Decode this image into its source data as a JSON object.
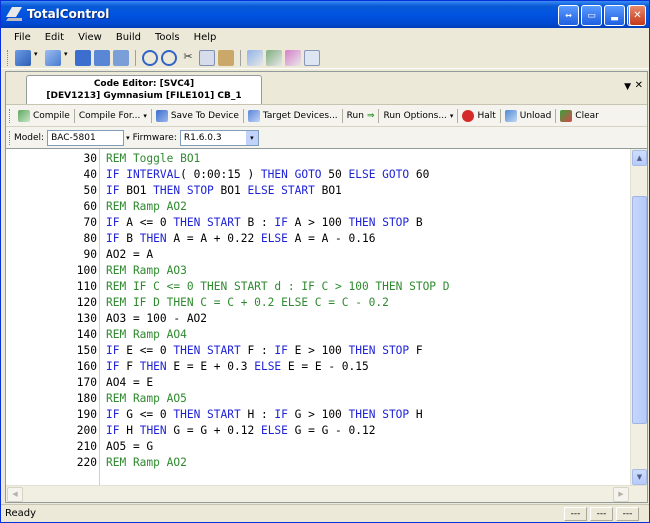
{
  "window": {
    "title": "TotalControl"
  },
  "menu": [
    "File",
    "Edit",
    "View",
    "Build",
    "Tools",
    "Help"
  ],
  "document_tab": {
    "line1": "Code Editor: [SVC4]",
    "line2": "[DEV1213] Gymnasium [FILE101] CB_1"
  },
  "commands": {
    "compile": "Compile",
    "compile_for": "Compile For...",
    "save_to_device": "Save To Device",
    "target_devices": "Target Devices...",
    "run": "Run",
    "run_options": "Run Options...",
    "halt": "Halt",
    "unload": "Unload",
    "clear": "Clear"
  },
  "model": {
    "label": "Model:",
    "value": "BAC-5801"
  },
  "firmware": {
    "label": "Firmware:",
    "value": "R1.6.0.3"
  },
  "code_lines": [
    {
      "num": "30",
      "tokens": [
        {
          "t": "REM Toggle BO1",
          "c": "cm"
        }
      ]
    },
    {
      "num": "40",
      "tokens": [
        {
          "t": "IF INTERVAL",
          "c": "kw"
        },
        {
          "t": "( 0:00:15 ) ",
          "c": ""
        },
        {
          "t": "THEN GOTO",
          "c": "kw"
        },
        {
          "t": " 50 ",
          "c": ""
        },
        {
          "t": "ELSE GOTO",
          "c": "kw"
        },
        {
          "t": " 60",
          "c": ""
        }
      ]
    },
    {
      "num": "50",
      "tokens": [
        {
          "t": "IF",
          "c": "kw"
        },
        {
          "t": " BO1 ",
          "c": ""
        },
        {
          "t": "THEN STOP",
          "c": "kw"
        },
        {
          "t": " BO1 ",
          "c": ""
        },
        {
          "t": "ELSE START",
          "c": "kw"
        },
        {
          "t": " BO1",
          "c": ""
        }
      ]
    },
    {
      "num": "60",
      "tokens": [
        {
          "t": "REM Ramp AO2",
          "c": "cm"
        }
      ]
    },
    {
      "num": "70",
      "tokens": [
        {
          "t": "IF",
          "c": "kw"
        },
        {
          "t": " A <= 0 ",
          "c": ""
        },
        {
          "t": "THEN START",
          "c": "kw"
        },
        {
          "t": " B : ",
          "c": ""
        },
        {
          "t": "IF",
          "c": "kw"
        },
        {
          "t": " A > 100 ",
          "c": ""
        },
        {
          "t": "THEN STOP",
          "c": "kw"
        },
        {
          "t": " B",
          "c": ""
        }
      ]
    },
    {
      "num": "80",
      "tokens": [
        {
          "t": "IF",
          "c": "kw"
        },
        {
          "t": " B ",
          "c": ""
        },
        {
          "t": "THEN",
          "c": "kw"
        },
        {
          "t": " A = A + 0.22 ",
          "c": ""
        },
        {
          "t": "ELSE",
          "c": "kw"
        },
        {
          "t": " A = A - 0.16",
          "c": ""
        }
      ]
    },
    {
      "num": "90",
      "tokens": [
        {
          "t": "AO2 = A",
          "c": ""
        }
      ]
    },
    {
      "num": "100",
      "tokens": [
        {
          "t": "REM Ramp AO3",
          "c": "cm"
        }
      ]
    },
    {
      "num": "110",
      "tokens": [
        {
          "t": "REM IF C <= 0 THEN START d : IF C > 100 THEN STOP D",
          "c": "cm"
        }
      ]
    },
    {
      "num": "120",
      "tokens": [
        {
          "t": "REM IF D THEN C = C + 0.2 ELSE C = C - 0.2",
          "c": "cm"
        }
      ]
    },
    {
      "num": "130",
      "tokens": [
        {
          "t": "AO3 = 100 - AO2",
          "c": ""
        }
      ]
    },
    {
      "num": "140",
      "tokens": [
        {
          "t": "REM Ramp AO4",
          "c": "cm"
        }
      ]
    },
    {
      "num": "150",
      "tokens": [
        {
          "t": "IF",
          "c": "kw"
        },
        {
          "t": " E <= 0 ",
          "c": ""
        },
        {
          "t": "THEN START",
          "c": "kw"
        },
        {
          "t": " F : ",
          "c": ""
        },
        {
          "t": "IF",
          "c": "kw"
        },
        {
          "t": " E > 100 ",
          "c": ""
        },
        {
          "t": "THEN STOP",
          "c": "kw"
        },
        {
          "t": " F",
          "c": ""
        }
      ]
    },
    {
      "num": "160",
      "tokens": [
        {
          "t": "IF",
          "c": "kw"
        },
        {
          "t": " F ",
          "c": ""
        },
        {
          "t": "THEN",
          "c": "kw"
        },
        {
          "t": " E = E + 0.3 ",
          "c": ""
        },
        {
          "t": "ELSE",
          "c": "kw"
        },
        {
          "t": " E = E - 0.15",
          "c": ""
        }
      ]
    },
    {
      "num": "170",
      "tokens": [
        {
          "t": "AO4 = E",
          "c": ""
        }
      ]
    },
    {
      "num": "180",
      "tokens": [
        {
          "t": "REM Ramp AO5",
          "c": "cm"
        }
      ]
    },
    {
      "num": "190",
      "tokens": [
        {
          "t": "IF",
          "c": "kw"
        },
        {
          "t": " G <= 0 ",
          "c": ""
        },
        {
          "t": "THEN START",
          "c": "kw"
        },
        {
          "t": " H : ",
          "c": ""
        },
        {
          "t": "IF",
          "c": "kw"
        },
        {
          "t": " G > 100 ",
          "c": ""
        },
        {
          "t": "THEN STOP",
          "c": "kw"
        },
        {
          "t": " H",
          "c": ""
        }
      ]
    },
    {
      "num": "200",
      "tokens": [
        {
          "t": "IF",
          "c": "kw"
        },
        {
          "t": " H ",
          "c": ""
        },
        {
          "t": "THEN",
          "c": "kw"
        },
        {
          "t": " G = G + 0.12 ",
          "c": ""
        },
        {
          "t": "ELSE",
          "c": "kw"
        },
        {
          "t": " G = G - 0.12",
          "c": ""
        }
      ]
    },
    {
      "num": "210",
      "tokens": [
        {
          "t": "AO5 = G",
          "c": ""
        }
      ]
    },
    {
      "num": "220",
      "tokens": [
        {
          "t": "REM Ramp AO2",
          "c": "cm"
        }
      ]
    }
  ],
  "status": {
    "text": "Ready",
    "cells": [
      "---",
      "---",
      "---"
    ]
  }
}
